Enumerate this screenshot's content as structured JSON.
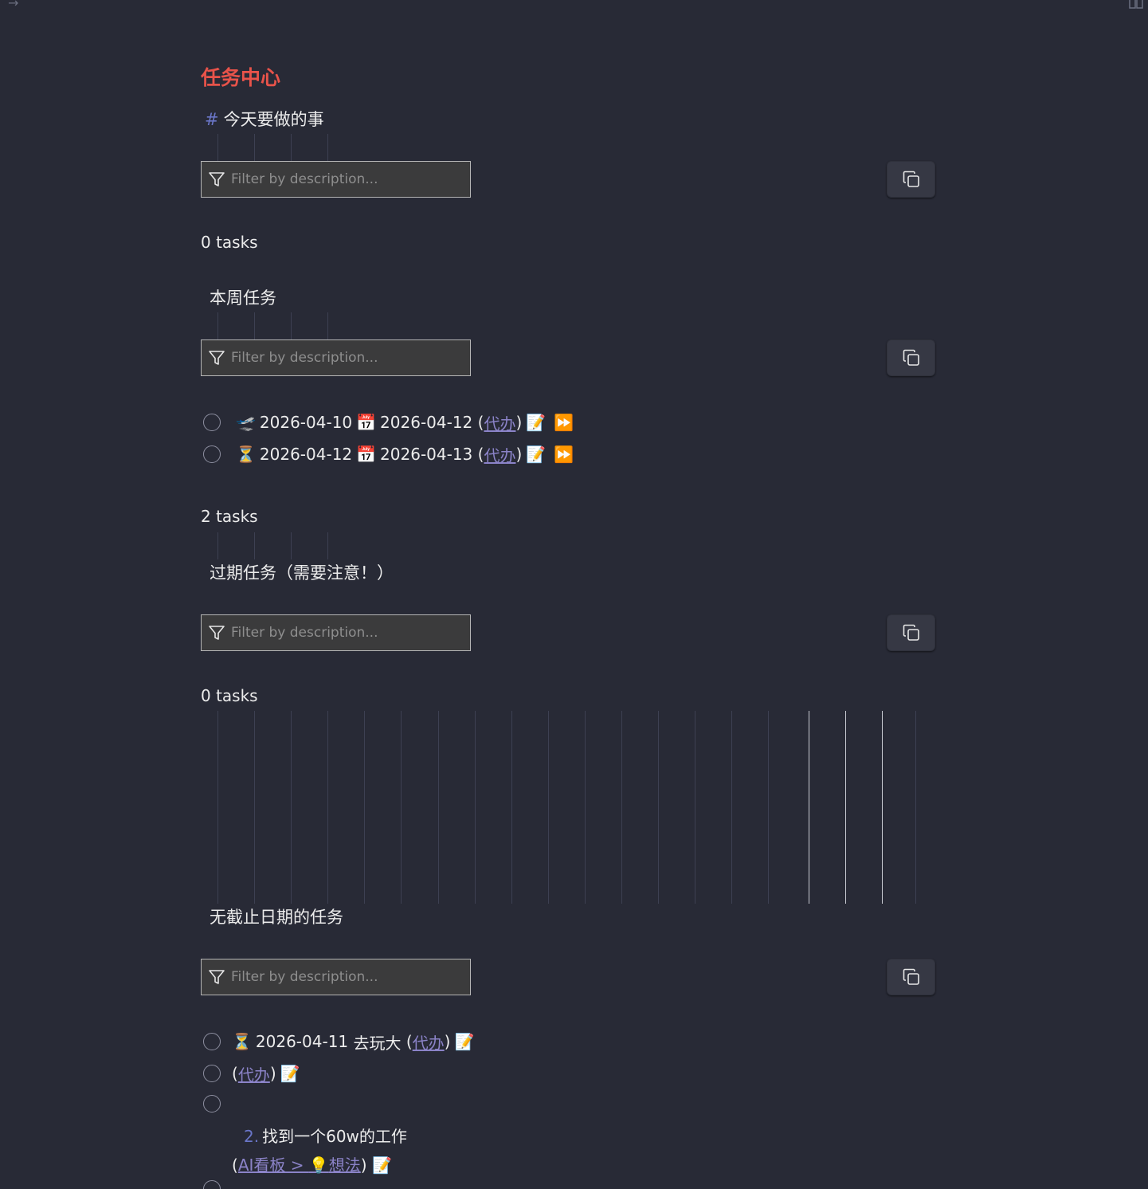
{
  "title": "任务中心",
  "filter_placeholder": "Filter by description...",
  "sections": [
    {
      "heading_hash": "#",
      "heading": "今天要做的事",
      "count": "0 tasks"
    },
    {
      "heading": "本周任务",
      "count": "2 tasks"
    },
    {
      "heading": "过期任务（需要注意！）",
      "count": "0 tasks"
    },
    {
      "heading": "无截止日期的任务"
    }
  ],
  "week_tasks": [
    {
      "start_icon": "🛫",
      "start_date": "2026-04-10",
      "due_icon": "📅",
      "due_date": "2026-04-12",
      "link": "代办",
      "edit_icon": "📝",
      "postpone_icon": "⏩"
    },
    {
      "start_icon": "⏳",
      "start_date": "2026-04-12",
      "due_icon": "📅",
      "due_date": "2026-04-13",
      "link": "代办",
      "edit_icon": "📝",
      "postpone_icon": "⏩"
    }
  ],
  "nodate_tasks": [
    {
      "icon": "⏳",
      "date": "2026-04-11",
      "text": "去玩大",
      "link": "代办",
      "edit_icon": "📝"
    },
    {
      "link": "代办",
      "edit_icon": "📝"
    },
    {
      "list_number": "2.",
      "text": "找到一个60w的工作",
      "link_part1": "AI看板 > ",
      "link_icon": "💡",
      "link_part2": "想法",
      "edit_icon": "📝"
    }
  ],
  "punct": {
    "open": "(",
    "close": ")"
  }
}
